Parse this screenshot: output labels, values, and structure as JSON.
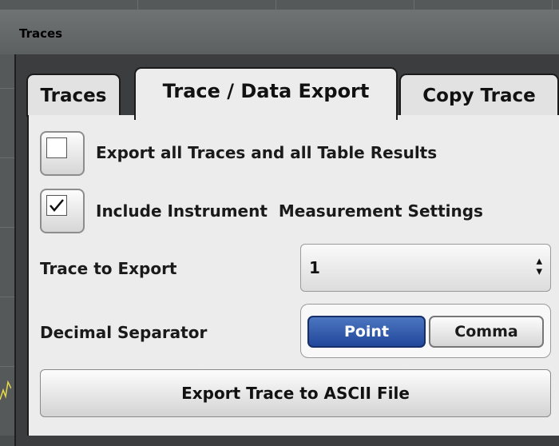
{
  "window": {
    "title": "Traces"
  },
  "tabs": [
    {
      "label": "Traces",
      "active": false
    },
    {
      "label": "Trace / Data Export",
      "active": true
    },
    {
      "label": "Copy Trace",
      "active": false
    }
  ],
  "export_all": {
    "label": "Export all Traces and all Table Results",
    "checked": false
  },
  "include_settings": {
    "label": "Include Instrument  Measurement Settings",
    "checked": true
  },
  "trace_to_export": {
    "label": "Trace to Export",
    "value": "1"
  },
  "decimal_separator": {
    "label": "Decimal Separator",
    "options": [
      "Point",
      "Comma"
    ],
    "selected": "Point"
  },
  "export_button": {
    "label": "Export Trace to ASCII File"
  },
  "colors": {
    "selected_toggle": "#21479a",
    "panel": "#ececec",
    "frame": "#3b3d3e"
  }
}
